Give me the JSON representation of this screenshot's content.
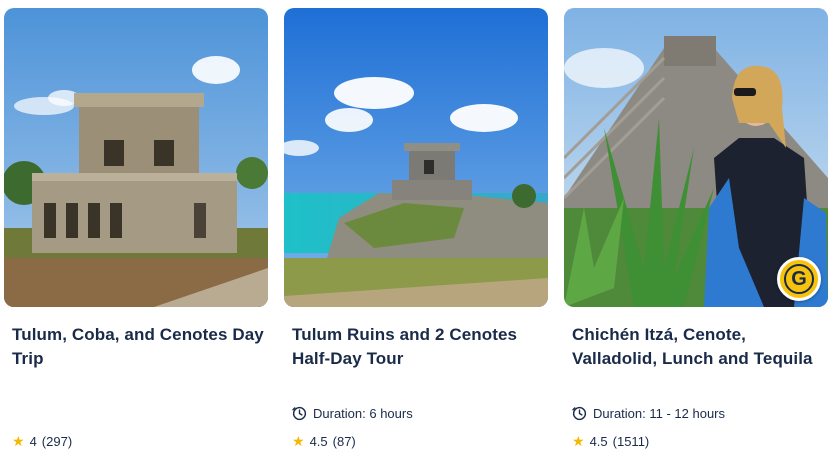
{
  "cards": [
    {
      "title": "Tulum, Coba, and Cenotes Day Trip",
      "duration": "",
      "rating": "4",
      "reviews": "(297)",
      "image_icon": "mayan-ruins-photo"
    },
    {
      "title": "Tulum Ruins and 2 Cenotes Half-Day Tour",
      "duration": "Duration: 6 hours",
      "rating": "4.5",
      "reviews": "(87)",
      "image_icon": "coastal-ruins-photo"
    },
    {
      "title": "Chichén Itzá, Cenote, Valladolid, Lunch and Tequila",
      "duration": "Duration: 11 - 12 hours",
      "rating": "4.5",
      "reviews": "(1511)",
      "image_icon": "pyramid-with-traveler-photo",
      "badge": "G"
    }
  ],
  "colors": {
    "text": "#1a2b49",
    "star": "#f5b800",
    "badge": "#f7c20b"
  }
}
